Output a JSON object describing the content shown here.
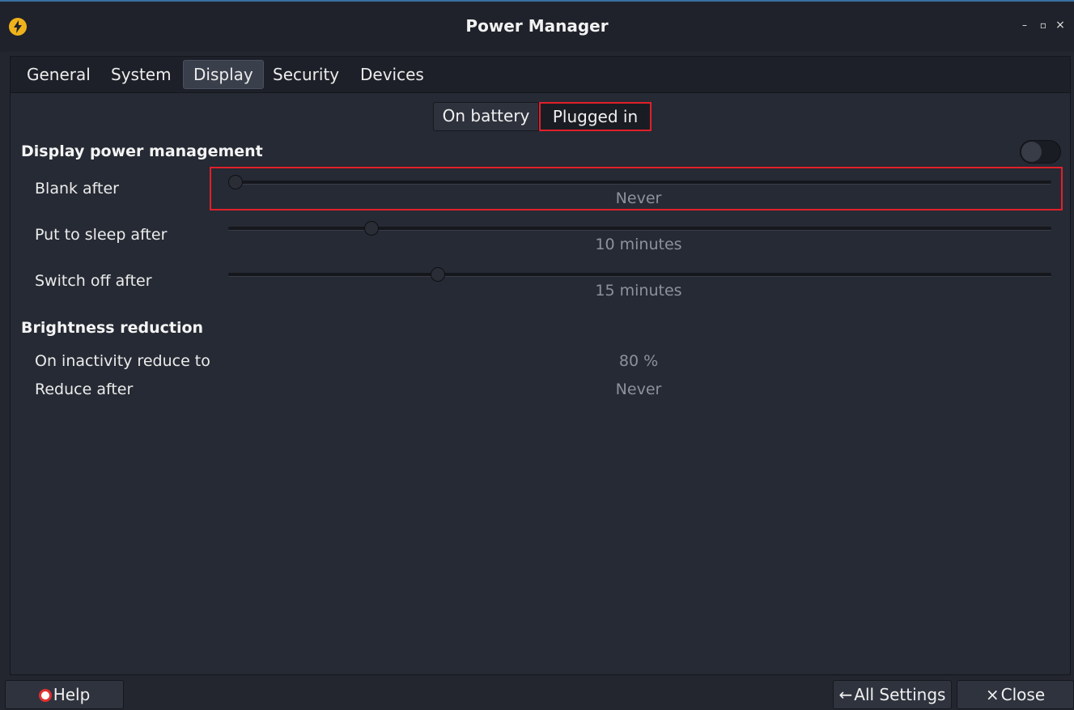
{
  "window": {
    "title": "Power Manager",
    "minimize_glyph": "–",
    "maximize_glyph": "▫",
    "close_glyph": "×",
    "app_icon": "lightning-bolt-icon",
    "app_icon_color": "#f0b21b"
  },
  "tabs": [
    {
      "label": "General",
      "active": false
    },
    {
      "label": "System",
      "active": false
    },
    {
      "label": "Display",
      "active": true
    },
    {
      "label": "Security",
      "active": false
    },
    {
      "label": "Devices",
      "active": false
    }
  ],
  "power_source": {
    "on_battery": "On battery",
    "plugged_in": "Plugged in",
    "selected": "Plugged in"
  },
  "display_power_management": {
    "title": "Display power management",
    "enabled": false,
    "blank_after": {
      "label": "Blank after",
      "value": "Never",
      "level": 0.0
    },
    "sleep_after": {
      "label": "Put to sleep after",
      "value": "10 minutes",
      "level": 0.168
    },
    "switch_off_after": {
      "label": "Switch off after",
      "value": "15 minutes",
      "level": 0.25
    }
  },
  "brightness_reduction": {
    "title": "Brightness reduction",
    "on_inactivity": {
      "label": "On inactivity reduce to",
      "value": "80 %"
    },
    "reduce_after": {
      "label": "Reduce after",
      "value": "Never"
    }
  },
  "buttons": {
    "help": "Help",
    "all_settings": "All Settings",
    "close": "Close",
    "all_settings_glyph": "←",
    "close_glyph": "×"
  },
  "colors": {
    "highlight": "#e0202a",
    "background": "#23262f"
  }
}
